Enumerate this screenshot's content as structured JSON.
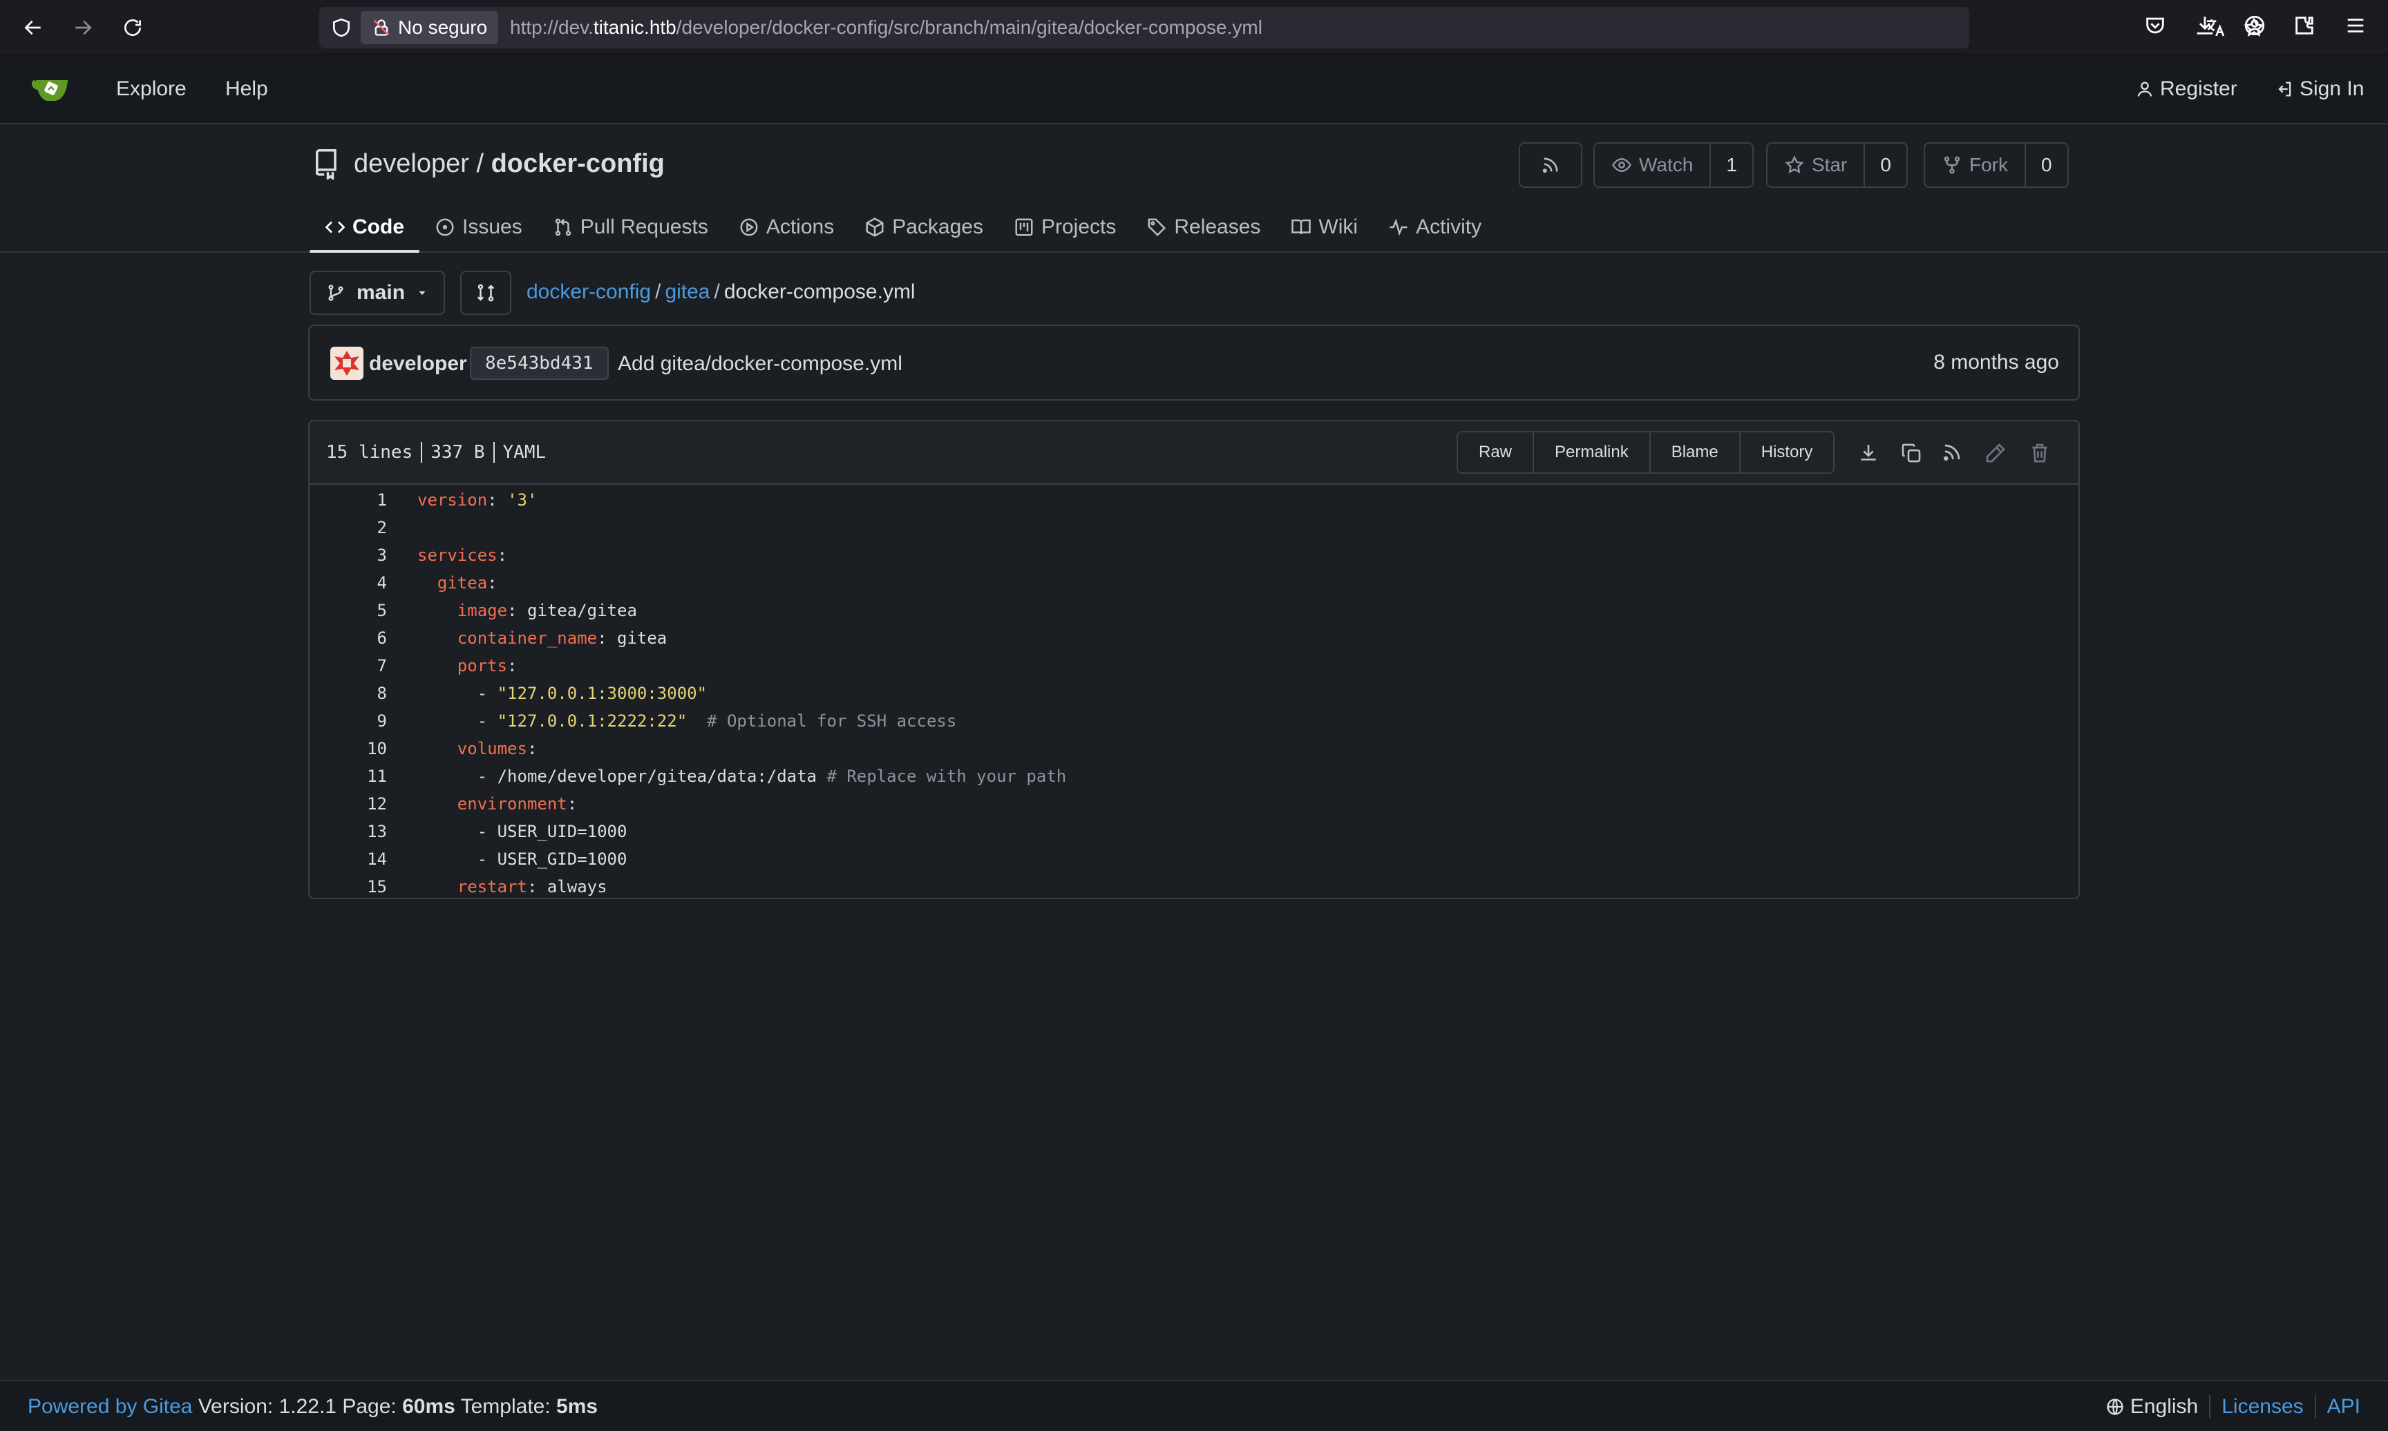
{
  "browser": {
    "security_label": "No seguro",
    "url_prefix": "http://dev.",
    "url_domain": "titanic.htb",
    "url_path": "/developer/docker-config/src/branch/main/gitea/docker-compose.yml"
  },
  "topnav": {
    "explore": "Explore",
    "help": "Help",
    "register": "Register",
    "sign_in": "Sign In"
  },
  "repo": {
    "owner": "developer",
    "separator": "/",
    "name": "docker-config",
    "watch_label": "Watch",
    "watch_count": "1",
    "star_label": "Star",
    "star_count": "0",
    "fork_label": "Fork",
    "fork_count": "0",
    "tabs": [
      {
        "label": "Code",
        "icon": "code-icon"
      },
      {
        "label": "Issues",
        "icon": "issue-icon"
      },
      {
        "label": "Pull Requests",
        "icon": "pull-request-icon"
      },
      {
        "label": "Actions",
        "icon": "play-icon"
      },
      {
        "label": "Packages",
        "icon": "package-icon"
      },
      {
        "label": "Projects",
        "icon": "project-icon"
      },
      {
        "label": "Releases",
        "icon": "tag-icon"
      },
      {
        "label": "Wiki",
        "icon": "book-icon"
      },
      {
        "label": "Activity",
        "icon": "pulse-icon"
      }
    ]
  },
  "branch": {
    "name": "main"
  },
  "breadcrumb": {
    "root": "docker-config",
    "dir": "gitea",
    "file": "docker-compose.yml",
    "sep": "/"
  },
  "commit": {
    "author": "developer",
    "sha": "8e543bd431",
    "message": "Add gitea/docker-compose.yml",
    "time": "8 months ago"
  },
  "file": {
    "lines_label": "15 lines",
    "size_label": "337 B",
    "type_label": "YAML",
    "buttons": {
      "raw": "Raw",
      "permalink": "Permalink",
      "blame": "Blame",
      "history": "History"
    },
    "code": [
      {
        "n": "1",
        "indent": "",
        "key": "version",
        "rest": ": ",
        "str": "'3'",
        "plain": "",
        "comment": ""
      },
      {
        "n": "2",
        "indent": "",
        "key": "",
        "rest": "",
        "str": "",
        "plain": "",
        "comment": ""
      },
      {
        "n": "3",
        "indent": "",
        "key": "services",
        "rest": ":",
        "str": "",
        "plain": "",
        "comment": ""
      },
      {
        "n": "4",
        "indent": "  ",
        "key": "gitea",
        "rest": ":",
        "str": "",
        "plain": "",
        "comment": ""
      },
      {
        "n": "5",
        "indent": "    ",
        "key": "image",
        "rest": ": ",
        "str": "",
        "plain": "gitea/gitea",
        "comment": ""
      },
      {
        "n": "6",
        "indent": "    ",
        "key": "container_name",
        "rest": ": ",
        "str": "",
        "plain": "gitea",
        "comment": ""
      },
      {
        "n": "7",
        "indent": "    ",
        "key": "ports",
        "rest": ":",
        "str": "",
        "plain": "",
        "comment": ""
      },
      {
        "n": "8",
        "indent": "      ",
        "key": "",
        "rest": "- ",
        "str": "\"127.0.0.1:3000:3000\"",
        "plain": "",
        "comment": ""
      },
      {
        "n": "9",
        "indent": "      ",
        "key": "",
        "rest": "- ",
        "str": "\"127.0.0.1:2222:22\"",
        "plain": "  ",
        "comment": "# Optional for SSH access"
      },
      {
        "n": "10",
        "indent": "    ",
        "key": "volumes",
        "rest": ":",
        "str": "",
        "plain": "",
        "comment": ""
      },
      {
        "n": "11",
        "indent": "      ",
        "key": "",
        "rest": "- ",
        "str": "",
        "plain": "/home/developer/gitea/data:/data ",
        "comment": "# Replace with your path"
      },
      {
        "n": "12",
        "indent": "    ",
        "key": "environment",
        "rest": ":",
        "str": "",
        "plain": "",
        "comment": ""
      },
      {
        "n": "13",
        "indent": "      ",
        "key": "",
        "rest": "- ",
        "str": "",
        "plain": "USER_UID=1000",
        "comment": ""
      },
      {
        "n": "14",
        "indent": "      ",
        "key": "",
        "rest": "- ",
        "str": "",
        "plain": "USER_GID=1000",
        "comment": ""
      },
      {
        "n": "15",
        "indent": "    ",
        "key": "restart",
        "rest": ": ",
        "str": "",
        "plain": "always",
        "comment": ""
      }
    ]
  },
  "footer": {
    "powered_by": "Powered by Gitea",
    "version_label": "Version:",
    "version": "1.22.1",
    "page_label": "Page:",
    "page_time": "60ms",
    "template_label": "Template:",
    "template_time": "5ms",
    "language": "English",
    "licenses": "Licenses",
    "api": "API"
  },
  "colors": {
    "background": "#1b1f24",
    "link": "#4b9ae0",
    "yaml_key": "#f26d4f",
    "yaml_string": "#e6d472",
    "yaml_comment": "#8b939c"
  }
}
